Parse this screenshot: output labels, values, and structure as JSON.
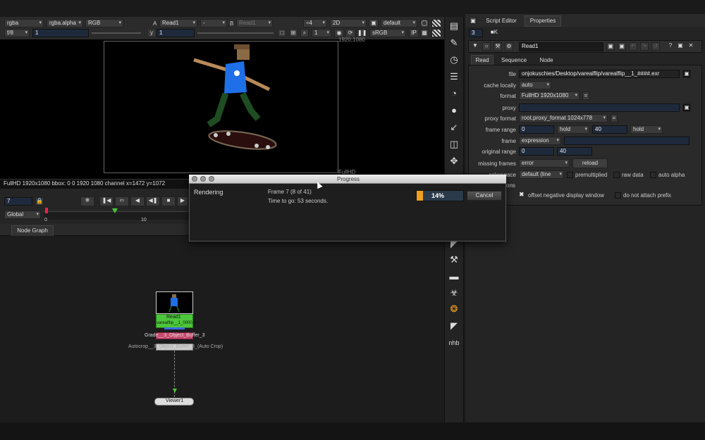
{
  "viewer": {
    "channels": "rgba",
    "alpha": "rgba.alpha",
    "colorspace": "RGB",
    "a_label": "A",
    "input_a": "Read1",
    "a_op": "-",
    "b_label": "B",
    "input_b": "Read1",
    "scale": "÷4",
    "view_mode": "2D",
    "lut": "default",
    "fstop": "f/8",
    "gain": "1",
    "y_label": "y",
    "gamma": "1",
    "proxy_scale": "1",
    "display": "sRGB",
    "ip": "IP",
    "res_label": "1920,1080",
    "format_label": "FullHD",
    "info_bar": "FullHD 1920x1080 bbox: 0 0 1920 1080 channel  x=1472 y=1072"
  },
  "timeline": {
    "frame": "7",
    "scope": "Global",
    "tick_start": "0",
    "tick_10": "10"
  },
  "node_graph": {
    "tab": "Node Graph",
    "read_node_name": "Read1",
    "read_node_file": "varealflip__1_0000.exr",
    "node2_label": "Grade__3_Object_Buffer_3",
    "node3_label": "Autocrop__3_Object_Buffer_3_(Auto Crop)",
    "viewer_node": "Viewer1"
  },
  "progress": {
    "title": "Progress",
    "status": "Rendering",
    "frame_text": "Frame 7 (8 of 41)",
    "time_text": "Time to go: 53 seconds.",
    "percent_label": "14%",
    "percent_value": 14,
    "cancel": "Cancel"
  },
  "right_panel": {
    "tab_script": "Script Editor",
    "tab_properties": "Properties",
    "count": "3",
    "node_name": "Read1",
    "tabs": [
      "Read",
      "Sequence",
      "Node"
    ],
    "file_label": "file",
    "file_value": "onjokuschies/Desktop/varealflip/varealflip__1_####.exr",
    "cache_label": "cache locally",
    "cache_value": "auto",
    "format_label": "format",
    "format_value": "FullHD 1920x1080",
    "proxy_label": "proxy",
    "proxy_format_label": "proxy format",
    "proxy_format_value": "root.proxy_format 1024x778",
    "frame_range_label": "frame range",
    "range_start": "0",
    "range_before": "hold",
    "range_end": "40",
    "range_after": "hold",
    "frame_label": "frame",
    "frame_value": "expression",
    "orig_range_label": "original range",
    "orig_start": "0",
    "orig_end": "40",
    "missing_label": "missing frames",
    "missing_value": "error",
    "reload": "reload",
    "colorspace_label": "colorspace",
    "colorspace_value": "default (line",
    "premultiplied": "premultiplied",
    "raw_data": "raw data",
    "auto_alpha": "auto alpha",
    "options_label": "ons",
    "offset_neg": "offset negative display window",
    "no_prefix": "do not attach prefix"
  },
  "toolbar_icons": [
    "viewer-icon",
    "paint-icon",
    "time-icon",
    "channel-icon",
    "color-icon",
    "draw-icon",
    "transform-icon",
    "merge-icon",
    "move-icon",
    "keyer-icon",
    "filter-icon",
    "misc-icon",
    "3d-icon",
    "nuke-icon",
    "other-icon",
    "nhb-icon"
  ],
  "colors": {
    "accent_green": "#4cc63a",
    "progress_orange": "#f0a020",
    "node_pink": "#c94a6e",
    "field_blue": "#1e2a3c"
  }
}
